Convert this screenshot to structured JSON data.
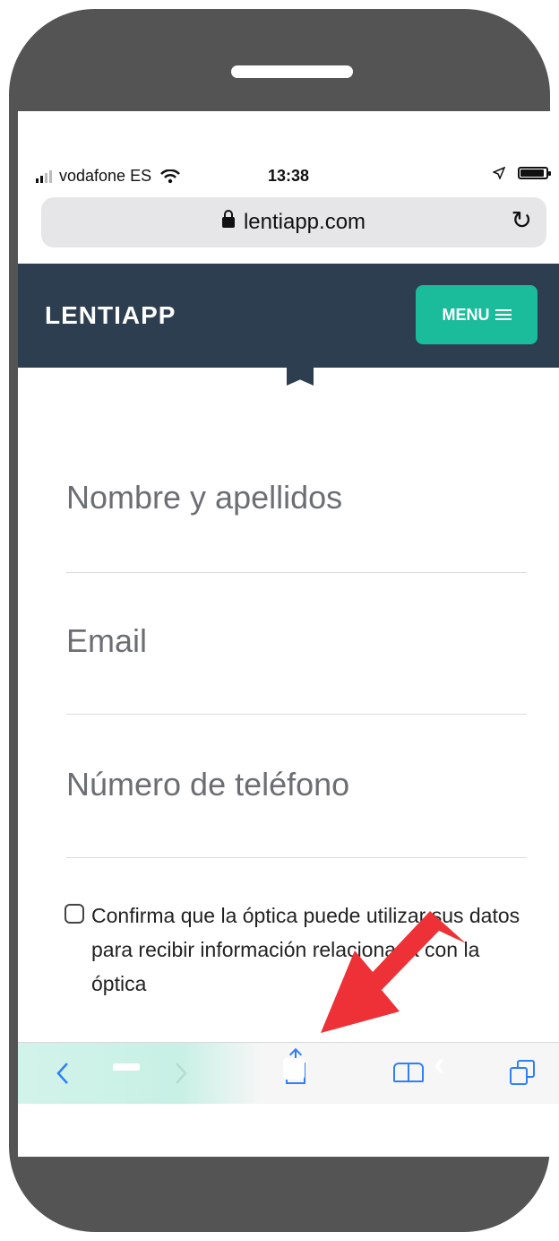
{
  "status_bar": {
    "carrier": "vodafone ES",
    "time": "13:38"
  },
  "address_bar": {
    "url": "lentiapp.com"
  },
  "site_header": {
    "brand": "LENTIAPP",
    "menu_label": "MENU"
  },
  "form": {
    "fields": [
      {
        "label": "Nombre y apellidos"
      },
      {
        "label": "Email"
      },
      {
        "label": "Número de teléfono"
      }
    ],
    "consent": {
      "text": "Confirma que la óptica puede utilizar sus datos para recibir información relacionada con la óptica",
      "checked": false
    }
  },
  "toolbar": {
    "items": [
      "back",
      "forward",
      "share",
      "bookmarks",
      "tabs"
    ]
  },
  "annotation": {
    "color": "#ee3136"
  },
  "colors": {
    "header": "#2c3e50",
    "menu_button": "#1abc9c",
    "toolbar_icons": "#2f7ff6"
  }
}
